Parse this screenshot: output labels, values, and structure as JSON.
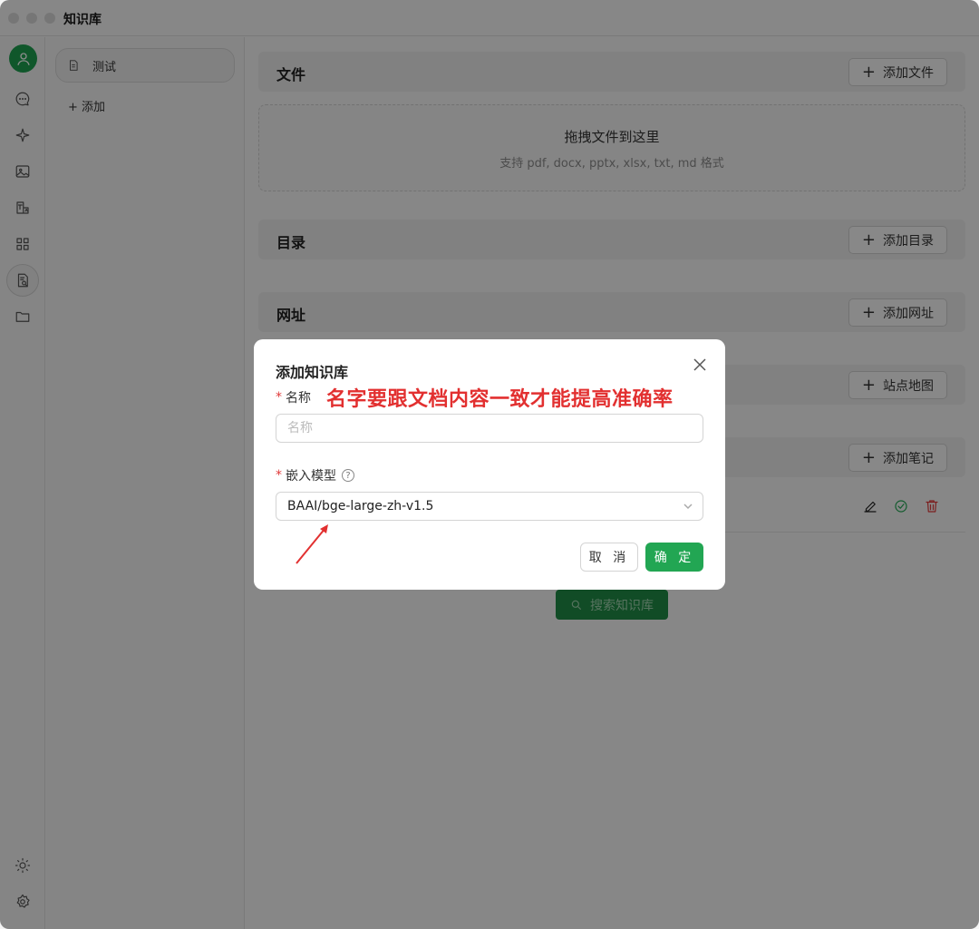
{
  "window": {
    "title": "知识库"
  },
  "sidebar": {
    "icons": [
      "avatar-icon",
      "chat-icon",
      "sparkle-icon",
      "image-icon",
      "translate-icon",
      "apps-icon",
      "knowledge-icon",
      "folder-icon",
      "theme-icon",
      "settings-icon"
    ]
  },
  "list": {
    "items": [
      {
        "label": "测试",
        "icon": "document-icon"
      }
    ],
    "add_label": "添加"
  },
  "main": {
    "files": {
      "title": "文件",
      "button": "添加文件",
      "drop_title": "拖拽文件到这里",
      "drop_hint": "支持 pdf, docx, pptx, xlsx, txt, md 格式"
    },
    "directory": {
      "title": "目录",
      "button": "添加目录"
    },
    "url": {
      "title": "网址",
      "button": "添加网址"
    },
    "sitemap": {
      "button": "站点地图"
    },
    "notes": {
      "button": "添加笔记"
    },
    "search_button": "搜索知识库"
  },
  "modal": {
    "title": "添加知识库",
    "name_label": "名称",
    "name_placeholder": "名称",
    "annotation": "名字要跟文档内容一致才能提高准确率",
    "model_label": "嵌入模型",
    "model_value": "BAAI/bge-large-zh-v1.5",
    "cancel_label": "取 消",
    "ok_label": "确 定"
  },
  "colors": {
    "accent": "#22a653",
    "annotation": "#e23030"
  }
}
